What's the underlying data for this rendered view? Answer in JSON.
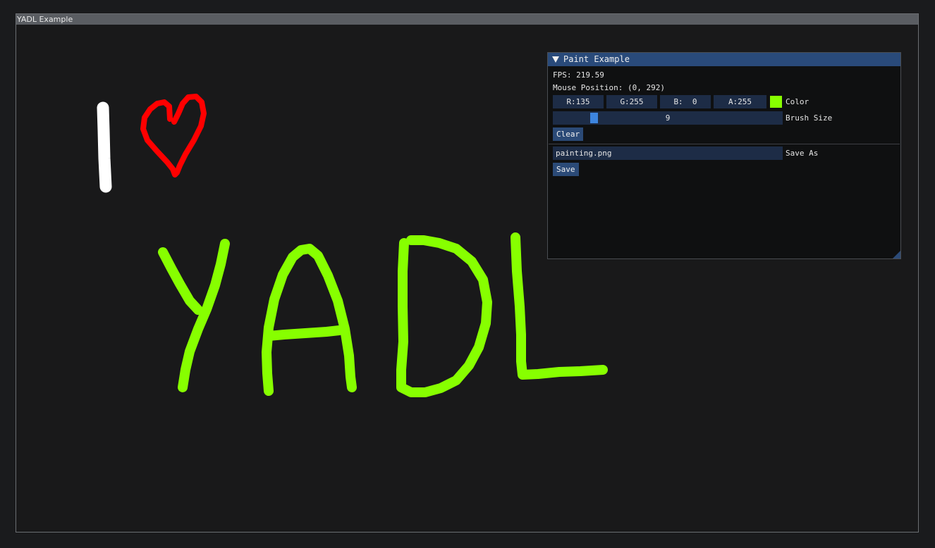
{
  "window": {
    "title": "YADL Example"
  },
  "panel": {
    "title": "Paint Example",
    "fps_text": "FPS: 219.59",
    "mouse_text": "Mouse Position: (0, 292)",
    "color": {
      "r_label": "R:135",
      "g_label": "G:255",
      "b_label": "B:  0",
      "a_label": "A:255",
      "swatch_hex": "#87ff00",
      "label": "Color"
    },
    "brush": {
      "value": "9",
      "label": "Brush Size"
    },
    "clear_label": "Clear",
    "save_as": {
      "value": "painting.png",
      "label": "Save As"
    },
    "save_label": "Save"
  },
  "drawing": {
    "colors": {
      "white": "#ffffff",
      "red": "#ff0000",
      "green": "#87ff00"
    }
  }
}
